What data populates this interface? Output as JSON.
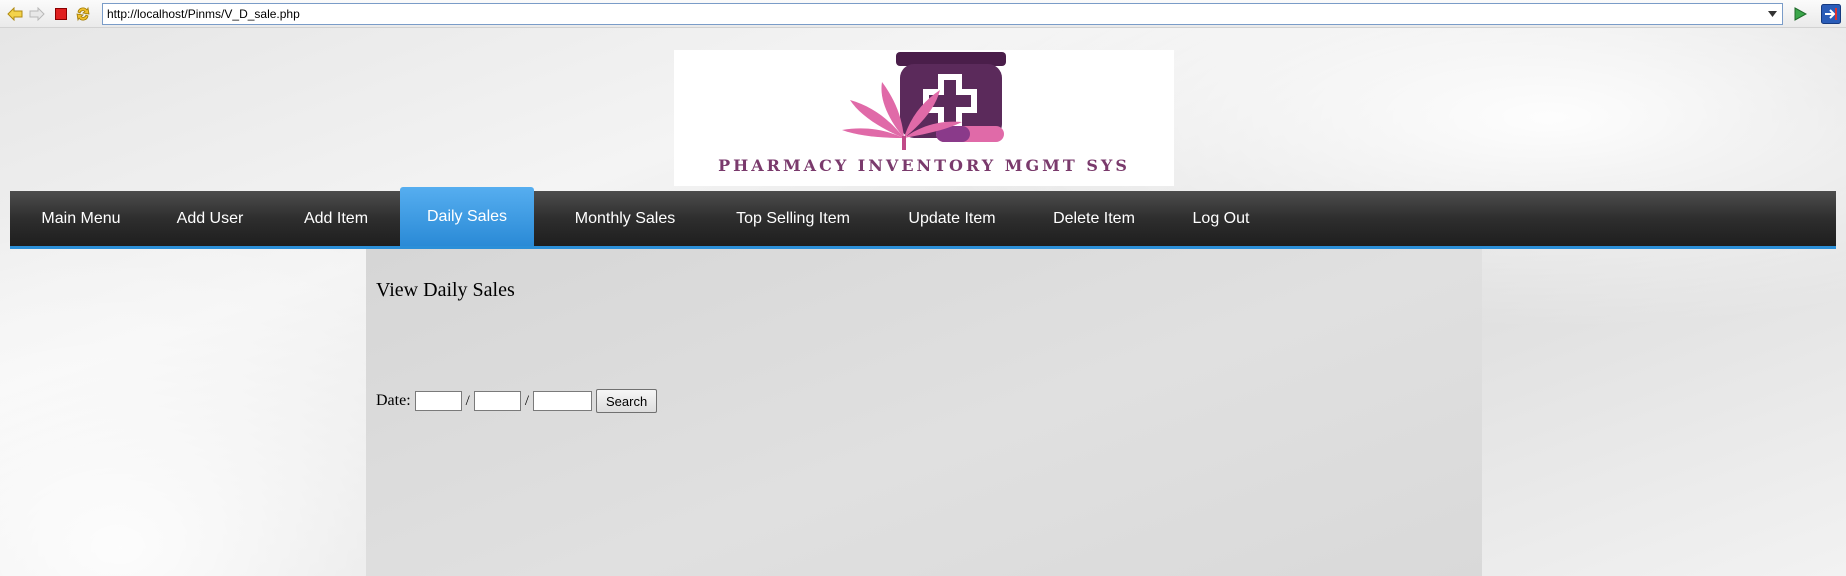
{
  "browser": {
    "url": "http://localhost/Pinms/V_D_sale.php",
    "icons": [
      "back-arrow-icon",
      "forward-arrow-icon",
      "stop-icon",
      "refresh-icon",
      "dropdown-arrow-icon",
      "go-icon",
      "exit-icon"
    ]
  },
  "header": {
    "logo_text": "PHARMACY INVENTORY MGMT SYS",
    "colors": {
      "logo_purple": "#5b2a5b",
      "logo_pink": "#e06aa8",
      "logo_text": "#7a3a6c"
    }
  },
  "nav": {
    "items": [
      {
        "label": "Main Menu"
      },
      {
        "label": "Add User"
      },
      {
        "label": "Add Item"
      },
      {
        "label": "Daily Sales"
      },
      {
        "label": "Monthly Sales"
      },
      {
        "label": "Top Selling Item"
      },
      {
        "label": "Update Item"
      },
      {
        "label": "Delete Item"
      },
      {
        "label": "Log Out"
      }
    ],
    "active": "Daily Sales",
    "colors": {
      "bar": "#2e2e2e",
      "accent": "#2b8fd8"
    }
  },
  "main": {
    "title": "View Daily Sales",
    "date_label": "Date:",
    "separator": "/",
    "day_value": "",
    "month_value": "",
    "year_value": "",
    "search_label": "Search"
  }
}
